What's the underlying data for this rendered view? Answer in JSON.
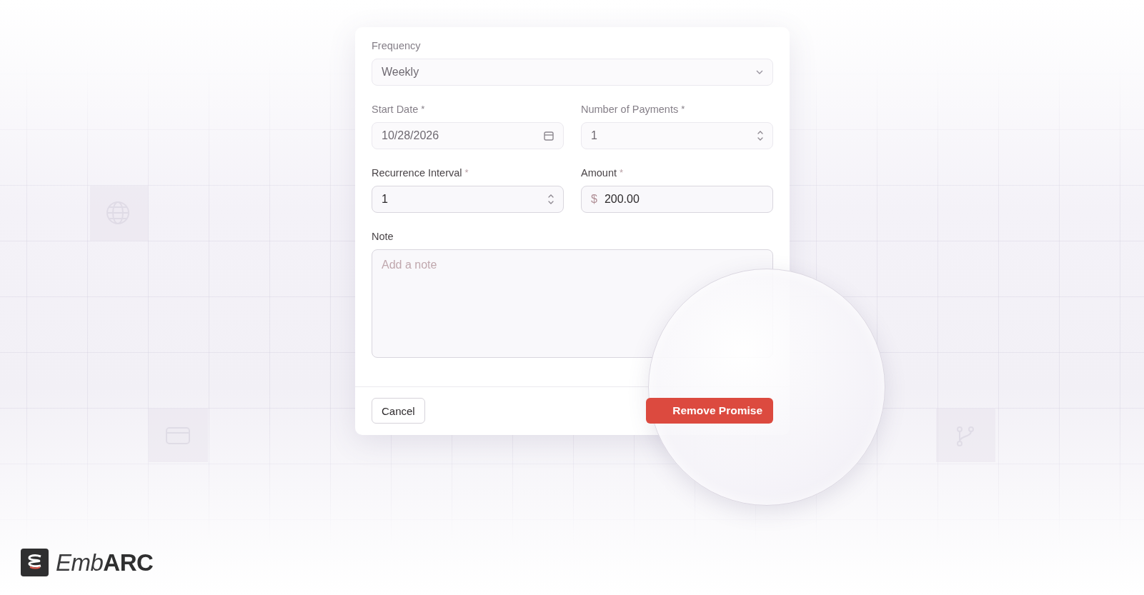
{
  "dialog": {
    "fields": [
      {
        "kind": "select",
        "label": "Frequency",
        "value": "Weekly",
        "faded": true
      },
      {
        "kind": "date",
        "label": "Start Date",
        "required_mark": "*",
        "value": "10/28/2026",
        "faded": true
      },
      {
        "kind": "number",
        "label": "Number of Payments",
        "required_mark": "*",
        "value": "1",
        "faded": true
      },
      {
        "kind": "number",
        "label": "Recurrence Interval",
        "required_mark": "*",
        "value": "1",
        "faded": false
      },
      {
        "kind": "currency",
        "label": "Amount",
        "required_mark": "*",
        "prefix": "$",
        "value": "200.00",
        "faded": false
      },
      {
        "kind": "textarea",
        "label": "Note",
        "placeholder": "Add a note",
        "faded": false
      }
    ],
    "buttons": [
      {
        "kind": "secondary",
        "label": "Cancel"
      },
      {
        "kind": "danger",
        "label": "Remove Promise"
      }
    ]
  },
  "logo": {
    "light": "Emb",
    "bold": "ARC"
  }
}
